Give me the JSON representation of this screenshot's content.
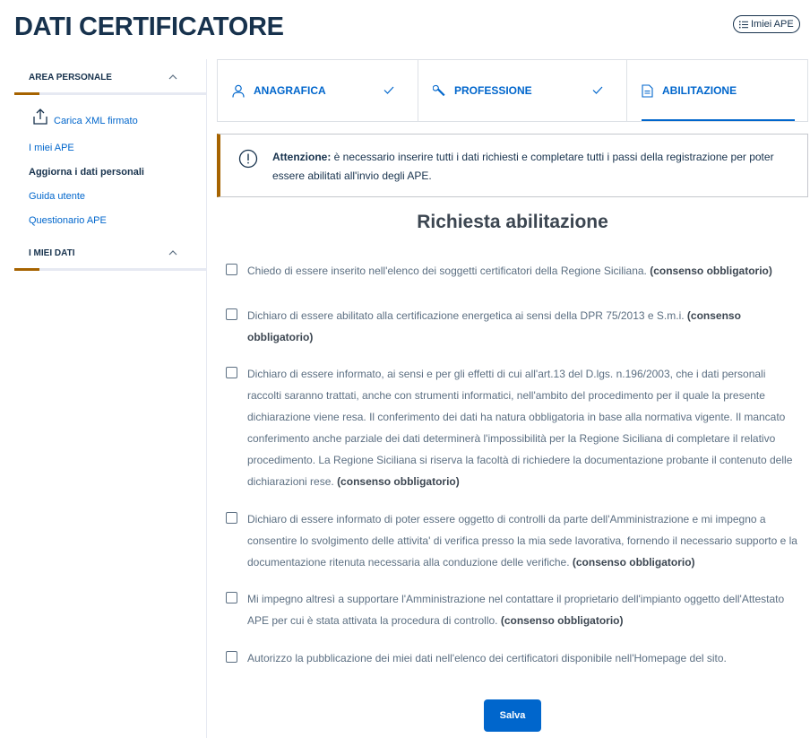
{
  "page_title": "DATI CERTIFICATORE",
  "header_pill": {
    "label": "Imiei APE"
  },
  "sidebar": {
    "sections": [
      {
        "title": "AREA PERSONALE"
      },
      {
        "title": "I MIEI DATI"
      }
    ],
    "links": [
      {
        "label": "Carica XML firmato",
        "icon": "upload-icon"
      },
      {
        "label": "I miei APE"
      },
      {
        "label": "Aggiorna i dati personali",
        "active": true
      },
      {
        "label": "Guida utente"
      },
      {
        "label": "Questionario APE"
      }
    ]
  },
  "tabs": [
    {
      "label": "ANAGRAFICA",
      "icon": "user-icon",
      "completed": true
    },
    {
      "label": "PROFESSIONE",
      "icon": "wrench-icon",
      "completed": true
    },
    {
      "label": "ABILITAZIONE",
      "icon": "document-icon",
      "active": true
    }
  ],
  "alert": {
    "bold": "Attenzione:",
    "text": " è necessario inserire tutti i dati richiesti e completare tutti i passi della registrazione per poter essere abilitati all'invio degli APE."
  },
  "section_title": "Richiesta abilitazione",
  "consents": [
    {
      "text": "Chiedo di essere inserito nell'elenco dei soggetti certificatori della Regione Siciliana. ",
      "bold": "(consenso obbligatorio)",
      "checked": false
    },
    {
      "text": "Dichiaro di essere abilitato alla certificazione energetica ai sensi della DPR 75/2013 e S.m.i. ",
      "bold": "(consenso obbligatorio)",
      "checked": false
    },
    {
      "text": "Dichiaro di essere informato, ai sensi e per gli effetti di cui all'art.13 del D.lgs. n.196/2003, che i dati personali raccolti saranno trattati, anche con strumenti informatici, nell'ambito del procedimento per il quale la presente dichiarazione viene resa. Il conferimento dei dati ha natura obbligatoria in base alla normativa vigente. Il mancato conferimento anche parziale dei dati determinerà l'impossibilità per la Regione Siciliana di completare il relativo procedimento. La Regione Siciliana si riserva la facoltà di richiedere la documentazione probante il contenuto delle dichiarazioni rese. ",
      "bold": "(consenso obbligatorio)",
      "checked": false
    },
    {
      "text": "Dichiaro di essere informato di poter essere oggetto di controlli da parte dell'Amministrazione e mi impegno a consentire lo svolgimento delle attivita' di verifica presso la mia sede lavorativa, fornendo il necessario supporto e la documentazione ritenuta necessaria alla conduzione delle verifiche. ",
      "bold": "(consenso obbligatorio)",
      "checked": false
    },
    {
      "text": "Mi impegno altresì a supportare l'Amministrazione nel contattare il proprietario dell'impianto oggetto dell'Attestato APE per cui è stata attivata la procedura di controllo. ",
      "bold": "(consenso obbligatorio)",
      "checked": false
    },
    {
      "text": "Autorizzo la pubblicazione dei miei dati nell'elenco dei certificatori disponibile nell'Homepage del sito.",
      "bold": "",
      "checked": false
    }
  ],
  "save_button": {
    "label": "Salva"
  },
  "colors": {
    "primary": "#0066cc",
    "accent": "#a66300",
    "title": "#17324d"
  }
}
